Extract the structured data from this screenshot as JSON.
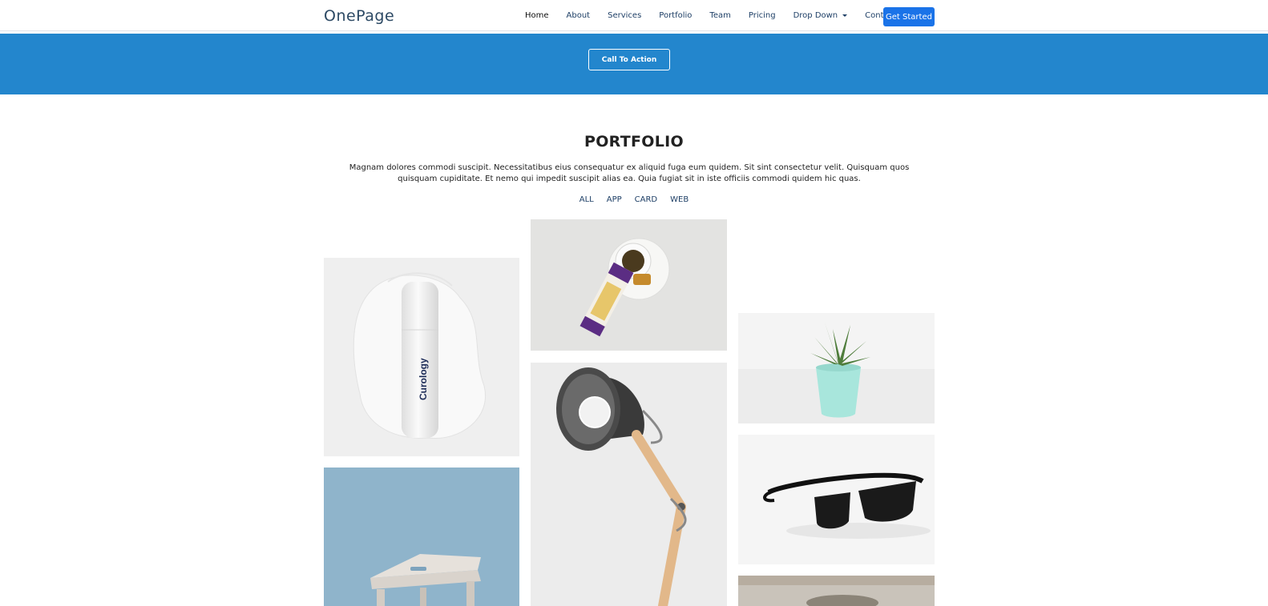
{
  "brand": {
    "logo": "OnePage"
  },
  "nav": {
    "items": [
      {
        "label": "Home"
      },
      {
        "label": "About"
      },
      {
        "label": "Services"
      },
      {
        "label": "Portfolio"
      },
      {
        "label": "Team"
      },
      {
        "label": "Pricing"
      },
      {
        "label": "Drop Down"
      },
      {
        "label": "Contact"
      }
    ],
    "cta": "Get Started"
  },
  "banner": {
    "button": "Call To Action"
  },
  "portfolio": {
    "title": "PORTFOLIO",
    "description": "Magnam dolores commodi suscipit. Necessitatibus eius consequatur ex aliquid fuga eum quidem. Sit sint consectetur velit. Quisquam quos quisquam cupiditate. Et nemo qui impedit suscipit alias ea. Quia fugiat sit in iste officiis commodi quidem hic quas.",
    "filters": [
      {
        "label": "ALL"
      },
      {
        "label": "APP"
      },
      {
        "label": "CARD"
      },
      {
        "label": "WEB"
      }
    ],
    "items": {
      "bottle_text": "Curology"
    }
  },
  "colors": {
    "banner": "#2386cd",
    "cta": "#1a73e8",
    "nav_text": "#1e3f66"
  }
}
